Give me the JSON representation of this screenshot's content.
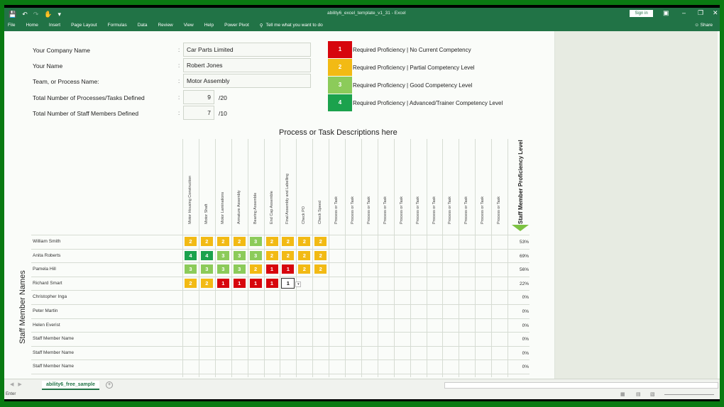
{
  "window": {
    "title": "ability6_excel_template_v1_31 - Excel",
    "sign_in": "Sign in",
    "share": "Share"
  },
  "ribbon": {
    "tabs": [
      "File",
      "Home",
      "Insert",
      "Page Layout",
      "Formulas",
      "Data",
      "Review",
      "View",
      "Help",
      "Power Pivot"
    ],
    "tell_me": "Tell me what you want to do"
  },
  "form": {
    "company_label": "Your Company Name",
    "company_value": "Car Parts Limited",
    "name_label": "Your Name",
    "name_value": "Robert Jones",
    "team_label": "Team, or Process Name:",
    "team_value": "Motor Assembly",
    "tasks_label": "Total Number of Processes/Tasks Defined",
    "tasks_value": "9",
    "tasks_max": "/20",
    "staff_label": "Total Number of Staff Members Defined",
    "staff_value": "7",
    "staff_max": "/10",
    "colon": ":"
  },
  "legend": [
    {
      "level": "1",
      "text": "Required Proficiency | No Current Competency",
      "color": "#d7060d"
    },
    {
      "level": "2",
      "text": "Required Proficiency | Partial Competency Level",
      "color": "#f2ba14"
    },
    {
      "level": "3",
      "text": "Required Proficiency | Good Competency Level",
      "color": "#8ccb5a"
    },
    {
      "level": "4",
      "text": "Required Proficiency | Advanced/Trainer Competency Level",
      "color": "#1ba24d"
    }
  ],
  "grid": {
    "title": "Process or Task Descriptions here",
    "side_label": "Staff Member Names",
    "proficiency_header": "Staff Member Proficiency Level",
    "columns": [
      "Motor Housing Construction",
      "Motor Shaft",
      "Motor Laminations",
      "Armature Assembly",
      "Bearing Assemble",
      "End Cap Assemble",
      "Final Assembly and Labelling",
      "Check PO",
      "Check Speed",
      "Process or Task",
      "Process or Task",
      "Process or Task",
      "Process or Task",
      "Process or Task",
      "Process or Task",
      "Process or Task",
      "Process or Task",
      "Process or Task",
      "Process or Task",
      "Process or Task"
    ],
    "rows": [
      {
        "name": "William Smith",
        "levels": [
          "2",
          "2",
          "2",
          "2",
          "3",
          "2",
          "2",
          "2",
          "2"
        ],
        "pct": "53%"
      },
      {
        "name": "Anita Roberts",
        "levels": [
          "4",
          "4",
          "3",
          "3",
          "3",
          "2",
          "2",
          "2",
          "2"
        ],
        "pct": "69%"
      },
      {
        "name": "Pamela Hill",
        "levels": [
          "3",
          "3",
          "3",
          "3",
          "2",
          "1",
          "1",
          "2",
          "2"
        ],
        "pct": "56%"
      },
      {
        "name": "Richard Smart",
        "levels": [
          "2",
          "2",
          "1",
          "1",
          "1",
          "1",
          "1"
        ],
        "pct": "22%"
      },
      {
        "name": "Christopher Inga",
        "levels": [],
        "pct": "0%"
      },
      {
        "name": "Peter Martin",
        "levels": [],
        "pct": "0%"
      },
      {
        "name": "Helen Everist",
        "levels": [],
        "pct": "0%"
      },
      {
        "name": "Staff Member Name",
        "levels": [],
        "pct": "0%"
      },
      {
        "name": "Staff Member Name",
        "levels": [],
        "pct": "0%"
      },
      {
        "name": "Staff Member Name",
        "levels": [],
        "pct": "0%"
      }
    ],
    "active_cell": {
      "row": 3,
      "col": 6
    }
  },
  "sheet_tabs": {
    "active": "ability6_free_sample",
    "add_label": "+"
  },
  "status": {
    "mode": "Enter"
  }
}
